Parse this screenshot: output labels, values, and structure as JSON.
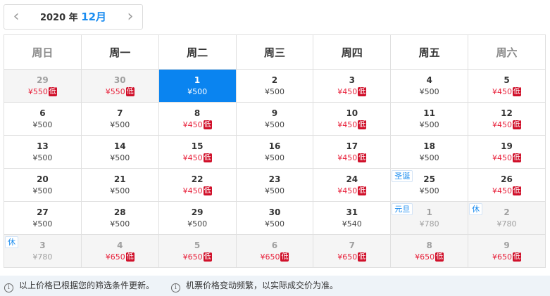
{
  "nav": {
    "prev": "‹",
    "next": "›",
    "year": "2020 年",
    "month": "12月"
  },
  "weekdays": [
    "周日",
    "周一",
    "周二",
    "周三",
    "周四",
    "周五",
    "周六"
  ],
  "low_badge": "低",
  "weeks": [
    [
      {
        "day": "29",
        "price": "¥550",
        "low": true,
        "other": true
      },
      {
        "day": "30",
        "price": "¥550",
        "low": true,
        "other": true
      },
      {
        "day": "1",
        "price": "¥500",
        "low": false,
        "selected": true
      },
      {
        "day": "2",
        "price": "¥500",
        "low": false
      },
      {
        "day": "3",
        "price": "¥450",
        "low": true
      },
      {
        "day": "4",
        "price": "¥500",
        "low": false
      },
      {
        "day": "5",
        "price": "¥450",
        "low": true
      }
    ],
    [
      {
        "day": "6",
        "price": "¥500",
        "low": false
      },
      {
        "day": "7",
        "price": "¥500",
        "low": false
      },
      {
        "day": "8",
        "price": "¥450",
        "low": true
      },
      {
        "day": "9",
        "price": "¥500",
        "low": false
      },
      {
        "day": "10",
        "price": "¥450",
        "low": true
      },
      {
        "day": "11",
        "price": "¥500",
        "low": false
      },
      {
        "day": "12",
        "price": "¥450",
        "low": true
      }
    ],
    [
      {
        "day": "13",
        "price": "¥500",
        "low": false
      },
      {
        "day": "14",
        "price": "¥500",
        "low": false
      },
      {
        "day": "15",
        "price": "¥450",
        "low": true
      },
      {
        "day": "16",
        "price": "¥500",
        "low": false
      },
      {
        "day": "17",
        "price": "¥450",
        "low": true
      },
      {
        "day": "18",
        "price": "¥500",
        "low": false
      },
      {
        "day": "19",
        "price": "¥450",
        "low": true
      }
    ],
    [
      {
        "day": "20",
        "price": "¥500",
        "low": false
      },
      {
        "day": "21",
        "price": "¥500",
        "low": false
      },
      {
        "day": "22",
        "price": "¥450",
        "low": true
      },
      {
        "day": "23",
        "price": "¥500",
        "low": false
      },
      {
        "day": "24",
        "price": "¥450",
        "low": true
      },
      {
        "day": "25",
        "price": "¥500",
        "low": false,
        "tag": "圣诞"
      },
      {
        "day": "26",
        "price": "¥450",
        "low": true
      }
    ],
    [
      {
        "day": "27",
        "price": "¥500",
        "low": false
      },
      {
        "day": "28",
        "price": "¥500",
        "low": false
      },
      {
        "day": "29",
        "price": "¥500",
        "low": false
      },
      {
        "day": "30",
        "price": "¥500",
        "low": false
      },
      {
        "day": "31",
        "price": "¥540",
        "low": false
      },
      {
        "day": "1",
        "price": "¥780",
        "low": false,
        "other": true,
        "tag": "元旦"
      },
      {
        "day": "2",
        "price": "¥780",
        "low": false,
        "other": true,
        "tag": "休"
      }
    ],
    [
      {
        "day": "3",
        "price": "¥780",
        "low": false,
        "other": true,
        "tag": "休"
      },
      {
        "day": "4",
        "price": "¥650",
        "low": true,
        "other": true
      },
      {
        "day": "5",
        "price": "¥650",
        "low": true,
        "other": true
      },
      {
        "day": "6",
        "price": "¥650",
        "low": true,
        "other": true
      },
      {
        "day": "7",
        "price": "¥650",
        "low": true,
        "other": true
      },
      {
        "day": "8",
        "price": "¥650",
        "low": true,
        "other": true
      },
      {
        "day": "9",
        "price": "¥650",
        "low": true,
        "other": true
      }
    ]
  ],
  "footer": {
    "info_icon": "i",
    "note1": "以上价格已根据您的筛选条件更新。",
    "note2": "机票价格变动频繁，以实际成交价为准。"
  }
}
